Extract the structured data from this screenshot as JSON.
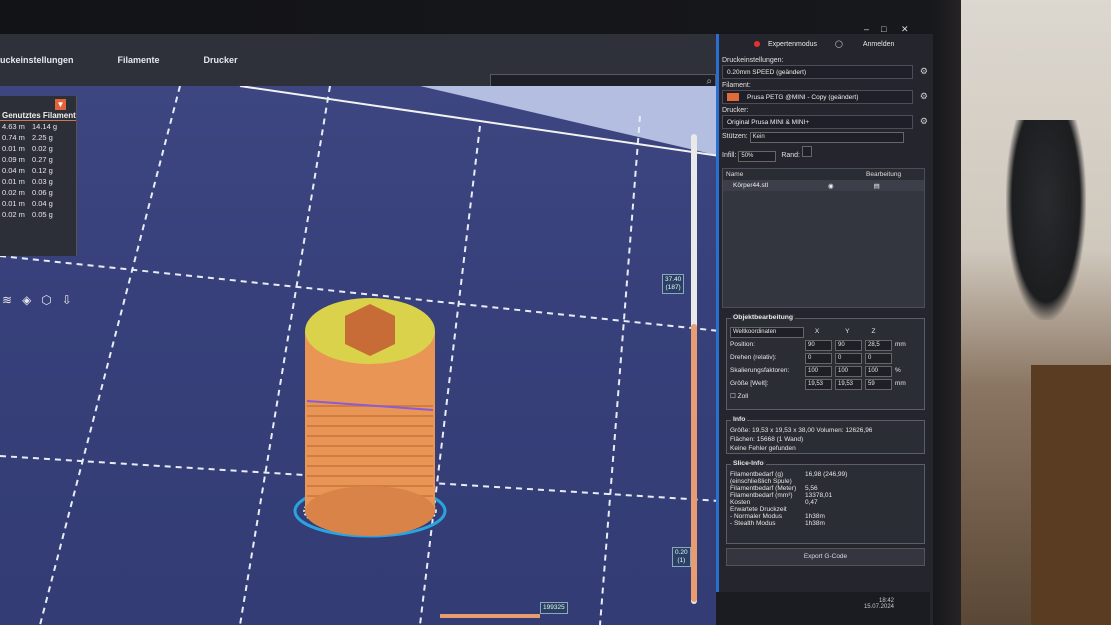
{
  "tabs": [
    "uckeinstellungen",
    "Filamente",
    "Drucker"
  ],
  "legend": {
    "header": "Genutztes Filament",
    "rows": [
      {
        "m": "4.63 m",
        "g": "14.14 g"
      },
      {
        "m": "0.74 m",
        "g": "2.25 g"
      },
      {
        "m": "0.01 m",
        "g": "0.02 g"
      },
      {
        "m": "0.09 m",
        "g": "0.27 g"
      },
      {
        "m": "0.04 m",
        "g": "0.12 g"
      },
      {
        "m": "0.01 m",
        "g": "0.03 g"
      },
      {
        "m": "0.02 m",
        "g": "0.06 g"
      },
      {
        "m": "0.01 m",
        "g": "0.04 g"
      },
      {
        "m": "0.02 m",
        "g": "0.05 g"
      }
    ]
  },
  "slider": {
    "top_label": "37.40",
    "top_sub": "(187)",
    "bottom_label": "0.20",
    "bottom_sub": "(1)",
    "h_label": "199325"
  },
  "window": {
    "mode": "Expertenmodus",
    "login": "Anmelden"
  },
  "print_settings": {
    "label": "Druckeinstellungen:",
    "value": "0.20mm SPEED (geändert)"
  },
  "filament": {
    "label": "Filament:",
    "value": "Prusa PETG @MINI - Copy (geändert)"
  },
  "printer": {
    "label": "Drucker:",
    "value": "Original Prusa MINI & MINI+"
  },
  "support": {
    "label": "Stützen:",
    "value": "Kein"
  },
  "infill": {
    "label": "Infill:",
    "value": "50%",
    "brim": "Rand:"
  },
  "objects": {
    "col_name": "Name",
    "col_edit": "Bearbeitung",
    "row": "Körper44.stl"
  },
  "manip": {
    "title": "Objektbearbeitung",
    "coords": "Weltkoordinaten",
    "x": "X",
    "y": "Y",
    "z": "Z",
    "position": "Position:",
    "pos": [
      "90",
      "90",
      "28,5"
    ],
    "rotate": "Drehen (relativ):",
    "rot": [
      "0",
      "0",
      "0"
    ],
    "scale": "Skalierungsfaktoren:",
    "sc": [
      "100",
      "100",
      "100"
    ],
    "size": "Größe [Welt]:",
    "sz": [
      "19,53",
      "19,53",
      "59"
    ],
    "unit_mm": "mm",
    "unit_pct": "%",
    "inch": "Zoll"
  },
  "info": {
    "title": "Info",
    "size_label": "Größe:",
    "size": "19,53 x 19,53 x 38,00",
    "volume_label": "Volumen:",
    "volume": "12626,96",
    "faces_label": "Flächen:",
    "faces": "15668 (1 Wand)",
    "errors": "Keine Fehler gefunden"
  },
  "slice": {
    "title": "Slice-Info",
    "rows": [
      {
        "k": "Filamentbedarf (g)",
        "v": "16,98 (246,99)"
      },
      {
        "k": "(einschließlich Spule)",
        "v": ""
      },
      {
        "k": "Filamentbedarf (Meter)",
        "v": "5,56"
      },
      {
        "k": "Filamentbedarf (mm³)",
        "v": "13378,01"
      },
      {
        "k": "Kosten",
        "v": "0,47"
      },
      {
        "k": "Erwartete Druckzeit",
        "v": ""
      },
      {
        "k": "- Normaler Modus",
        "v": "1h38m"
      },
      {
        "k": "- Stealth Modus",
        "v": "1h38m"
      }
    ],
    "export": "Export G-Code"
  },
  "clock": {
    "time": "18:42",
    "date": "15.07.2024"
  }
}
